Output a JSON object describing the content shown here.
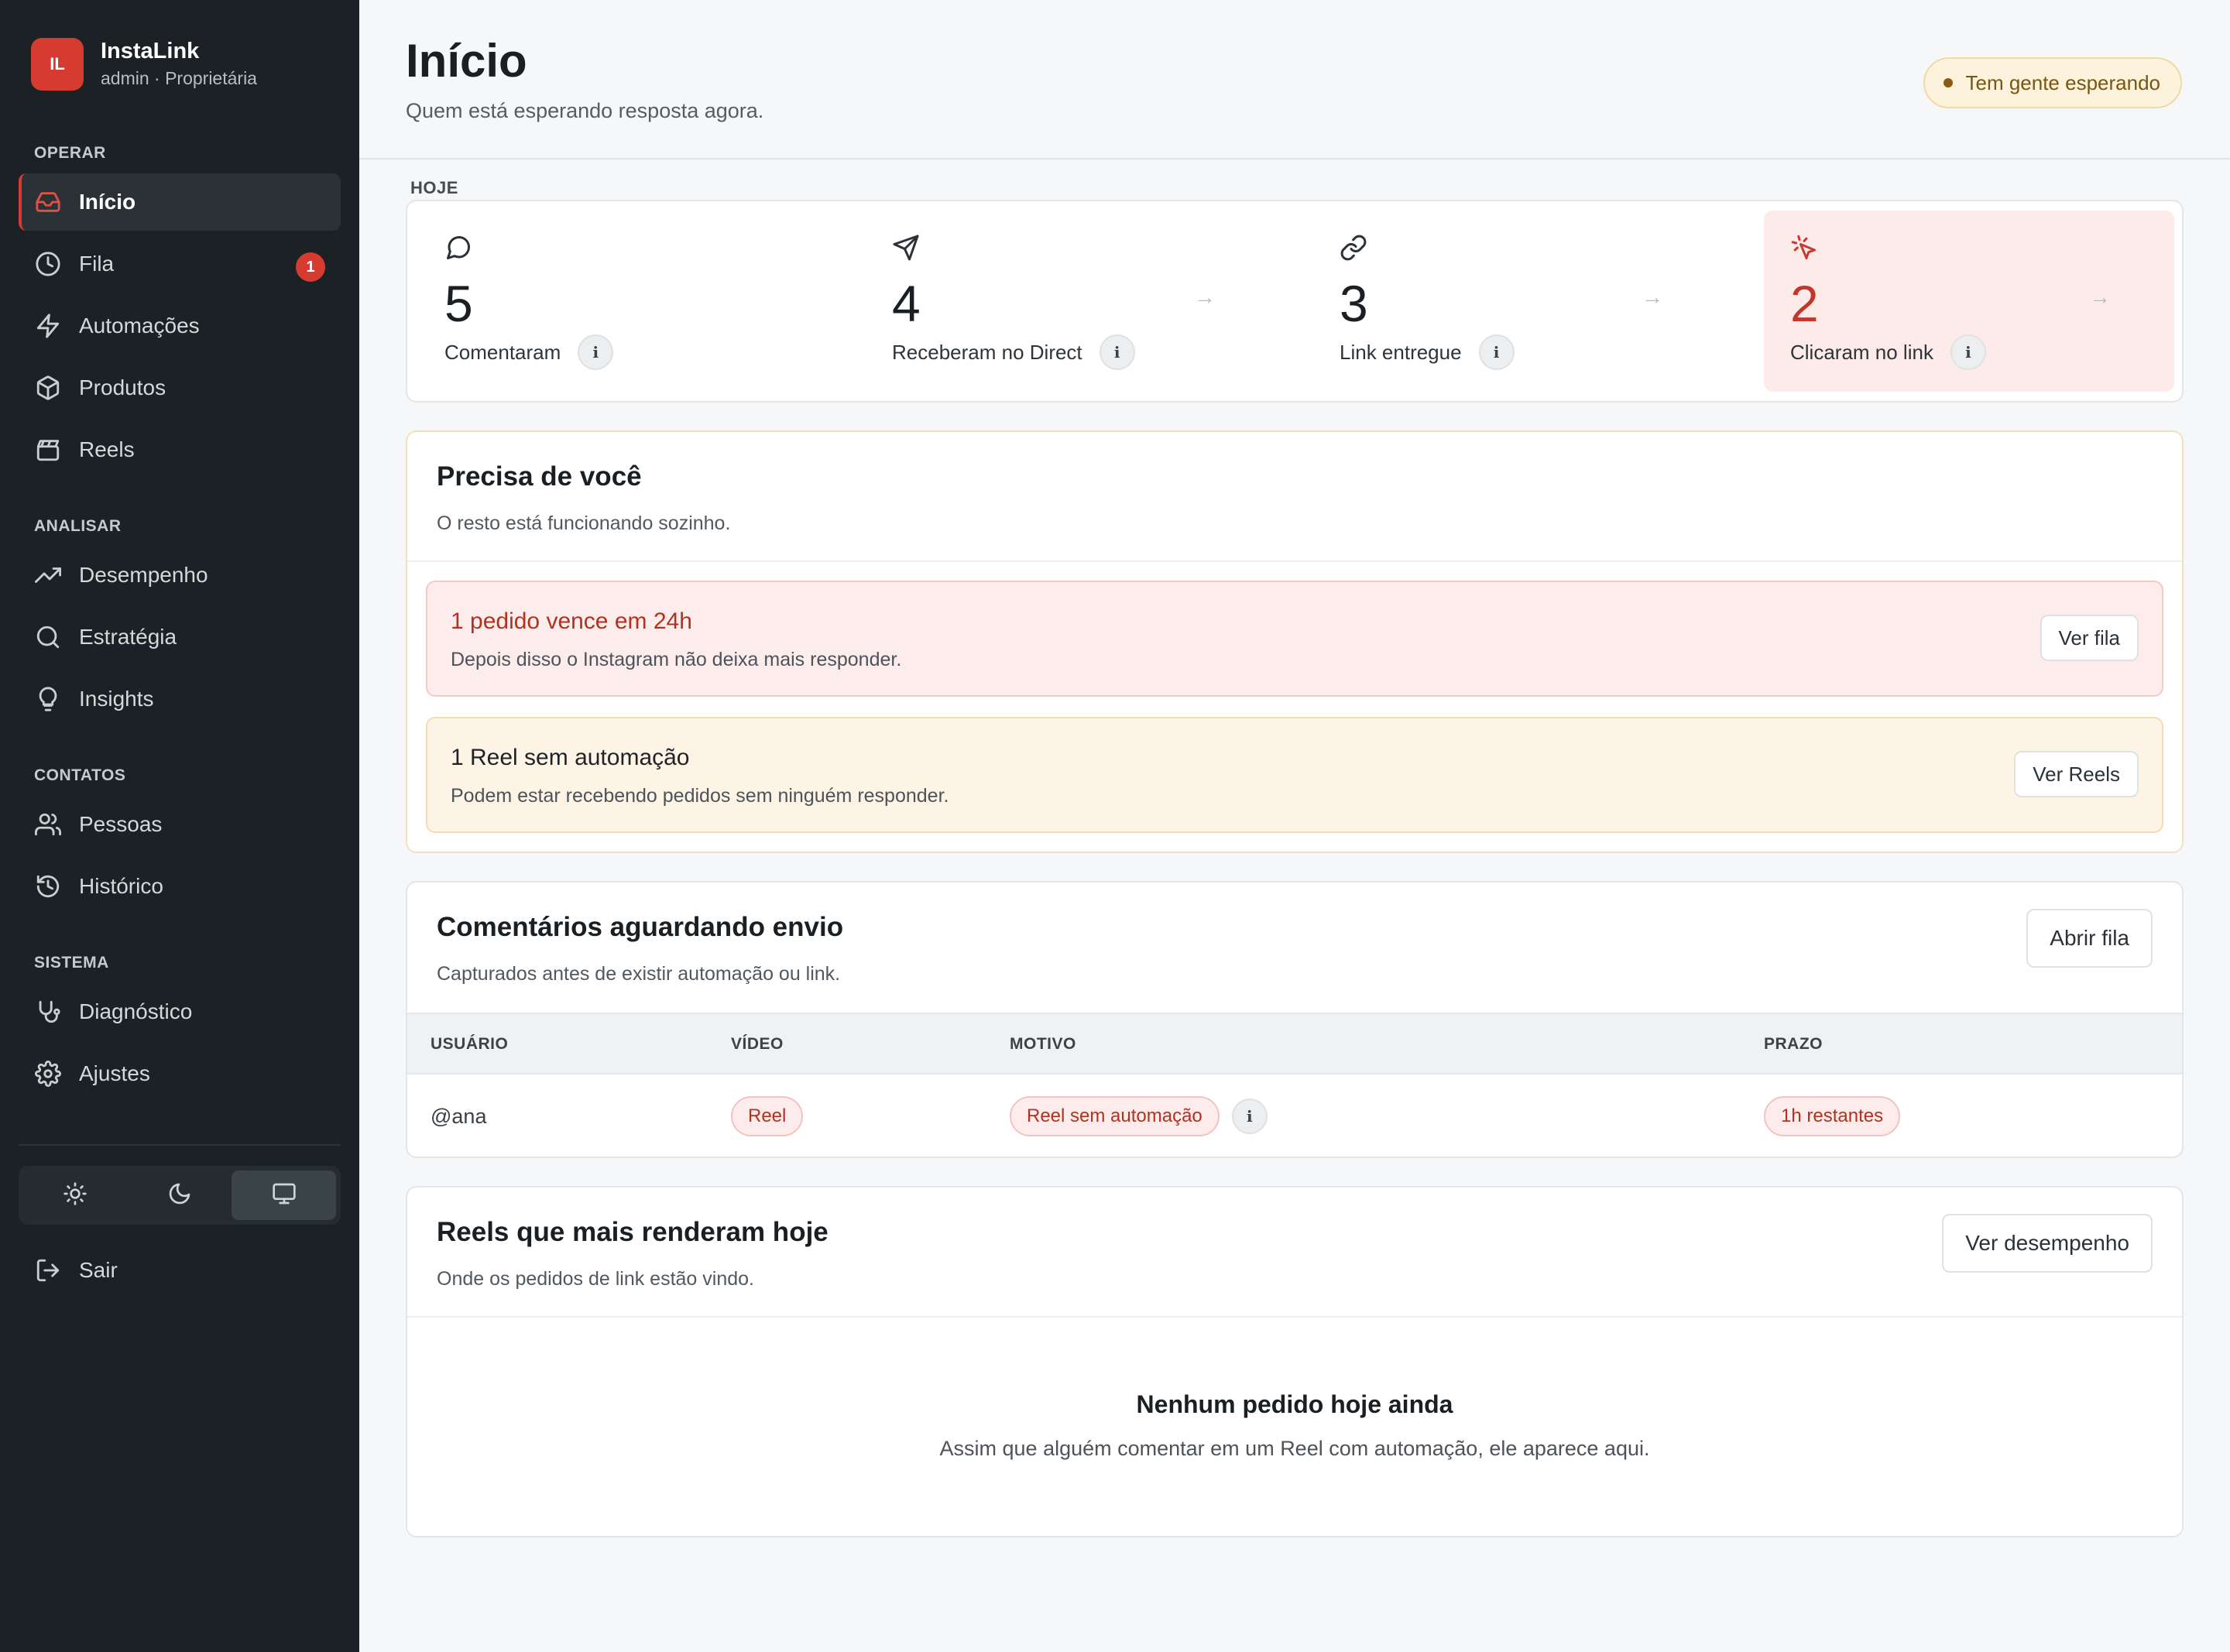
{
  "brand": {
    "logo": "IL",
    "name": "InstaLink",
    "subtitle": "admin · Proprietária",
    "color": "#d63b30"
  },
  "sidebar": {
    "sections": [
      {
        "heading": "OPERAR",
        "items": [
          {
            "label": "Início",
            "icon": "inbox-icon",
            "active": true
          },
          {
            "label": "Fila",
            "icon": "clock-icon",
            "badge": "1"
          },
          {
            "label": "Automações",
            "icon": "bolt-icon"
          },
          {
            "label": "Produtos",
            "icon": "box-icon"
          },
          {
            "label": "Reels",
            "icon": "clapperboard-icon"
          }
        ]
      },
      {
        "heading": "ANALISAR",
        "items": [
          {
            "label": "Desempenho",
            "icon": "trending-up-icon"
          },
          {
            "label": "Estratégia",
            "icon": "search-icon"
          },
          {
            "label": "Insights",
            "icon": "lightbulb-icon"
          }
        ]
      },
      {
        "heading": "CONTATOS",
        "items": [
          {
            "label": "Pessoas",
            "icon": "users-icon"
          },
          {
            "label": "Histórico",
            "icon": "history-icon"
          }
        ]
      },
      {
        "heading": "SISTEMA",
        "items": [
          {
            "label": "Diagnóstico",
            "icon": "stethoscope-icon"
          },
          {
            "label": "Ajustes",
            "icon": "gear-icon"
          }
        ]
      }
    ],
    "theme": {
      "options": [
        "sun-icon",
        "moon-icon",
        "monitor-icon"
      ],
      "selected": "monitor-icon"
    },
    "logout_label": "Sair"
  },
  "header": {
    "title": "Início",
    "subtitle": "Quem está esperando resposta agora.",
    "status": "Tem gente esperando"
  },
  "funnel": {
    "label": "HOJE",
    "steps": [
      {
        "value": "5",
        "label": "Comentaram",
        "icon": "message-circle-icon"
      },
      {
        "value": "4",
        "label": "Receberam no Direct",
        "icon": "send-icon"
      },
      {
        "value": "3",
        "label": "Link entregue",
        "icon": "link-icon"
      },
      {
        "value": "2",
        "label": "Clicaram no link",
        "icon": "mouse-pointer-click-icon",
        "highlight": true
      }
    ],
    "info_glyph": "i",
    "arrow_glyph": "→"
  },
  "needs_you": {
    "title": "Precisa de você",
    "subtitle": "O resto está funcionando sozinho.",
    "alerts": [
      {
        "title": "1 pedido vence em 24h",
        "text": "Depois disso o Instagram não deixa mais responder.",
        "action": "Ver fila",
        "tone": "red"
      },
      {
        "title": "1 Reel sem automação",
        "text": "Podem estar recebendo pedidos sem ninguém responder.",
        "action": "Ver Reels",
        "tone": "amber"
      }
    ]
  },
  "waiting": {
    "title": "Comentários aguardando envio",
    "subtitle": "Capturados antes de existir automação ou link.",
    "action": "Abrir fila",
    "columns": [
      "USUÁRIO",
      "VÍDEO",
      "MOTIVO",
      "PRAZO"
    ],
    "rows": [
      {
        "user": "@ana",
        "video": "Reel",
        "reason": "Reel sem automação",
        "deadline": "1h restantes"
      }
    ]
  },
  "top_reels": {
    "title": "Reels que mais renderam hoje",
    "subtitle": "Onde os pedidos de link estão vindo.",
    "action": "Ver desempenho",
    "empty_title": "Nenhum pedido hoje ainda",
    "empty_text": "Assim que alguém comentar em um Reel com automação, ele aparece aqui."
  }
}
